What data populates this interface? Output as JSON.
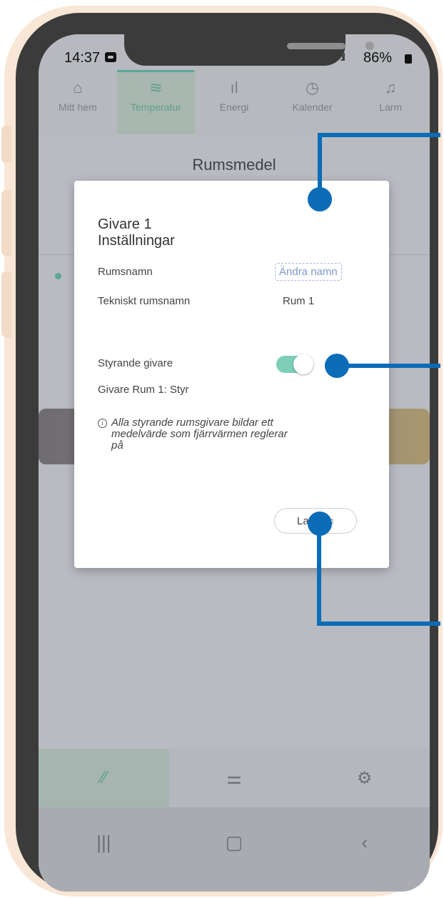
{
  "status": {
    "time": "14:37",
    "signal": ".ıl",
    "battery": "86%"
  },
  "nav": {
    "tabs": [
      {
        "label": "Mitt hem",
        "icon": "⌂",
        "icon_name": "home-icon"
      },
      {
        "label": "Temperatur",
        "icon": "≋",
        "icon_name": "temperature-icon"
      },
      {
        "label": "Energi",
        "icon": "ıl",
        "icon_name": "energy-icon"
      },
      {
        "label": "Kalender",
        "icon": "◷",
        "icon_name": "calendar-icon"
      },
      {
        "label": "Larm",
        "icon": "♫",
        "icon_name": "bell-icon"
      }
    ],
    "active": "Temperatur"
  },
  "background": {
    "section_title": "Rumsmedel"
  },
  "dialog": {
    "title_line1": "Givare 1",
    "title_line2": "Inställningar",
    "room_name_label": "Rumsnamn",
    "rename_link": "Ändra namn",
    "technical_name_label": "Tekniskt rumsnamn",
    "technical_name_value": "Rum 1",
    "controlling_sensor_label": "Styrande givare",
    "controlling_sensor_on": true,
    "sensor_status": "Givare Rum 1: Styr",
    "info_icon": "ⓘ",
    "info_text": "Alla styrande rumsgivare bildar ett medelvärde som fjärrvärmen reglerar på",
    "larm_button": "Larm"
  },
  "bottombar": {
    "items": [
      {
        "icon": "⁄⁄",
        "icon_name": "gauge-icon"
      },
      {
        "icon": "⚌",
        "icon_name": "sliders-icon"
      },
      {
        "icon": "⚙",
        "icon_name": "gear-icon"
      }
    ]
  },
  "system_nav": {
    "recent": "|||",
    "home": "▢",
    "back": "‹"
  },
  "colors": {
    "accent": "#58a895",
    "callout": "#0b6cb8",
    "frame": "#3b3b3b",
    "frame_outline": "#f8e7d6"
  }
}
